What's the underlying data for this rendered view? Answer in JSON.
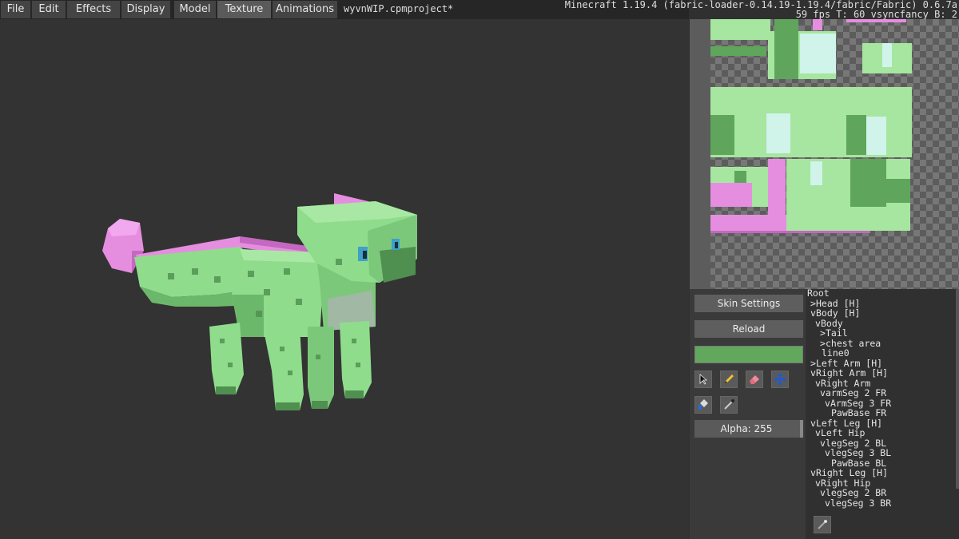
{
  "menu": {
    "items": [
      {
        "label": "File"
      },
      {
        "label": "Edit"
      },
      {
        "label": "Effects"
      },
      {
        "label": "Display"
      },
      {
        "label": "Model"
      },
      {
        "label": "Texture"
      },
      {
        "label": "Animations"
      }
    ],
    "active": "Texture",
    "project_title": "wyvnWIP.cpmproject*"
  },
  "sysinfo": {
    "line1": "Minecraft 1.19.4 (fabric-loader-0.14.19-1.19.4/fabric/Fabric) 0.6.7a",
    "line2": "59 fps T: 60 vsyncfancy B: 2"
  },
  "tools": {
    "skin_settings": "Skin Settings",
    "reload": "Reload",
    "paint_color": "#62a85c",
    "alpha_label": "Alpha: 255",
    "alpha_value": 255,
    "icons": [
      "select-icon",
      "pencil-icon",
      "eraser-icon",
      "move-icon",
      "fill-icon",
      "color-picker-icon"
    ]
  },
  "tree": {
    "nodes": [
      {
        "label": "Root",
        "arrow": ""
      },
      {
        "label": "Head [H]",
        "arrow": ">"
      },
      {
        "label": "Body [H]",
        "arrow": "v"
      },
      {
        "label": "Body",
        "arrow": "v"
      },
      {
        "label": "Tail",
        "arrow": ">"
      },
      {
        "label": "chest area",
        "arrow": ">"
      },
      {
        "label": "line0",
        "arrow": ""
      },
      {
        "label": "Left Arm [H]",
        "arrow": ">"
      },
      {
        "label": "Right Arm [H]",
        "arrow": "v"
      },
      {
        "label": "Right Arm",
        "arrow": "v"
      },
      {
        "label": "armSeg 2 FR",
        "arrow": "v"
      },
      {
        "label": "ArmSeg 3 FR",
        "arrow": "v"
      },
      {
        "label": "PawBase FR",
        "arrow": ""
      },
      {
        "label": "Left Leg [H]",
        "arrow": "v"
      },
      {
        "label": "Left Hip",
        "arrow": "v"
      },
      {
        "label": "legSeg 2 BL",
        "arrow": "v"
      },
      {
        "label": "legSeg 3 BL",
        "arrow": "v"
      },
      {
        "label": "PawBase BL",
        "arrow": ""
      },
      {
        "label": "Right Leg [H]",
        "arrow": "v"
      },
      {
        "label": "Right Hip",
        "arrow": "v"
      },
      {
        "label": "legSeg 2 BR",
        "arrow": "v"
      },
      {
        "label": "legSeg 3 BR",
        "arrow": "v"
      }
    ]
  },
  "colors": {
    "model_green": "#8fdc8c",
    "model_dark_green": "#4f8f4f",
    "model_pink": "#e58ee0",
    "eye_blue": "#3fa0c8"
  }
}
